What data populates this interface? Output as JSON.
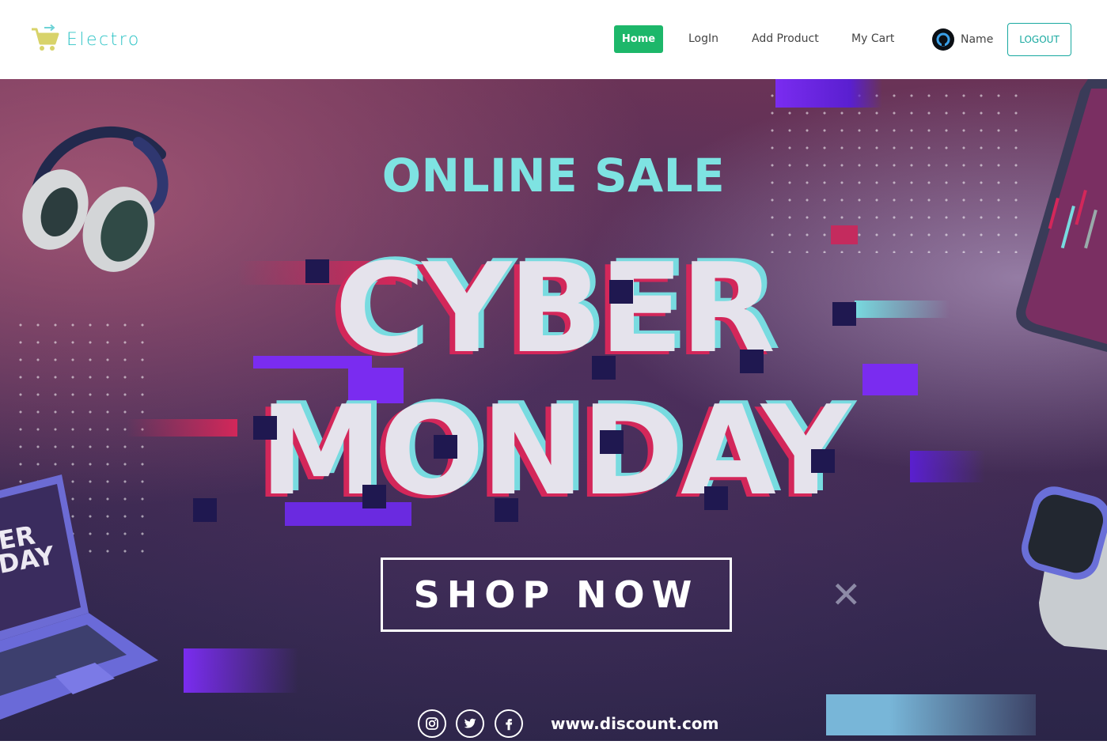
{
  "brand": {
    "name": "Electro",
    "icon": "cart-icon",
    "accent_color": "#2ec4c6",
    "icon_color": "#d8d36a"
  },
  "nav": {
    "home": "Home",
    "login": "LogIn",
    "add_product": "Add Product",
    "cart": "My Cart",
    "user_name": "Name",
    "logout": "LOGOUT",
    "active_color": "#1db76a"
  },
  "hero": {
    "headline": "ONLINE SALE",
    "line1": "CYBER",
    "line2": "MONDAY",
    "cta": "SHOP NOW",
    "url": "www.discount.com",
    "laptop_screen_text": [
      "ER",
      "DAY"
    ],
    "social_icons": [
      "instagram-icon",
      "twitter-icon",
      "facebook-icon"
    ],
    "colors": {
      "teal": "#7ee3e2",
      "pink": "#d3275a",
      "purple": "#7a2cf0"
    }
  }
}
